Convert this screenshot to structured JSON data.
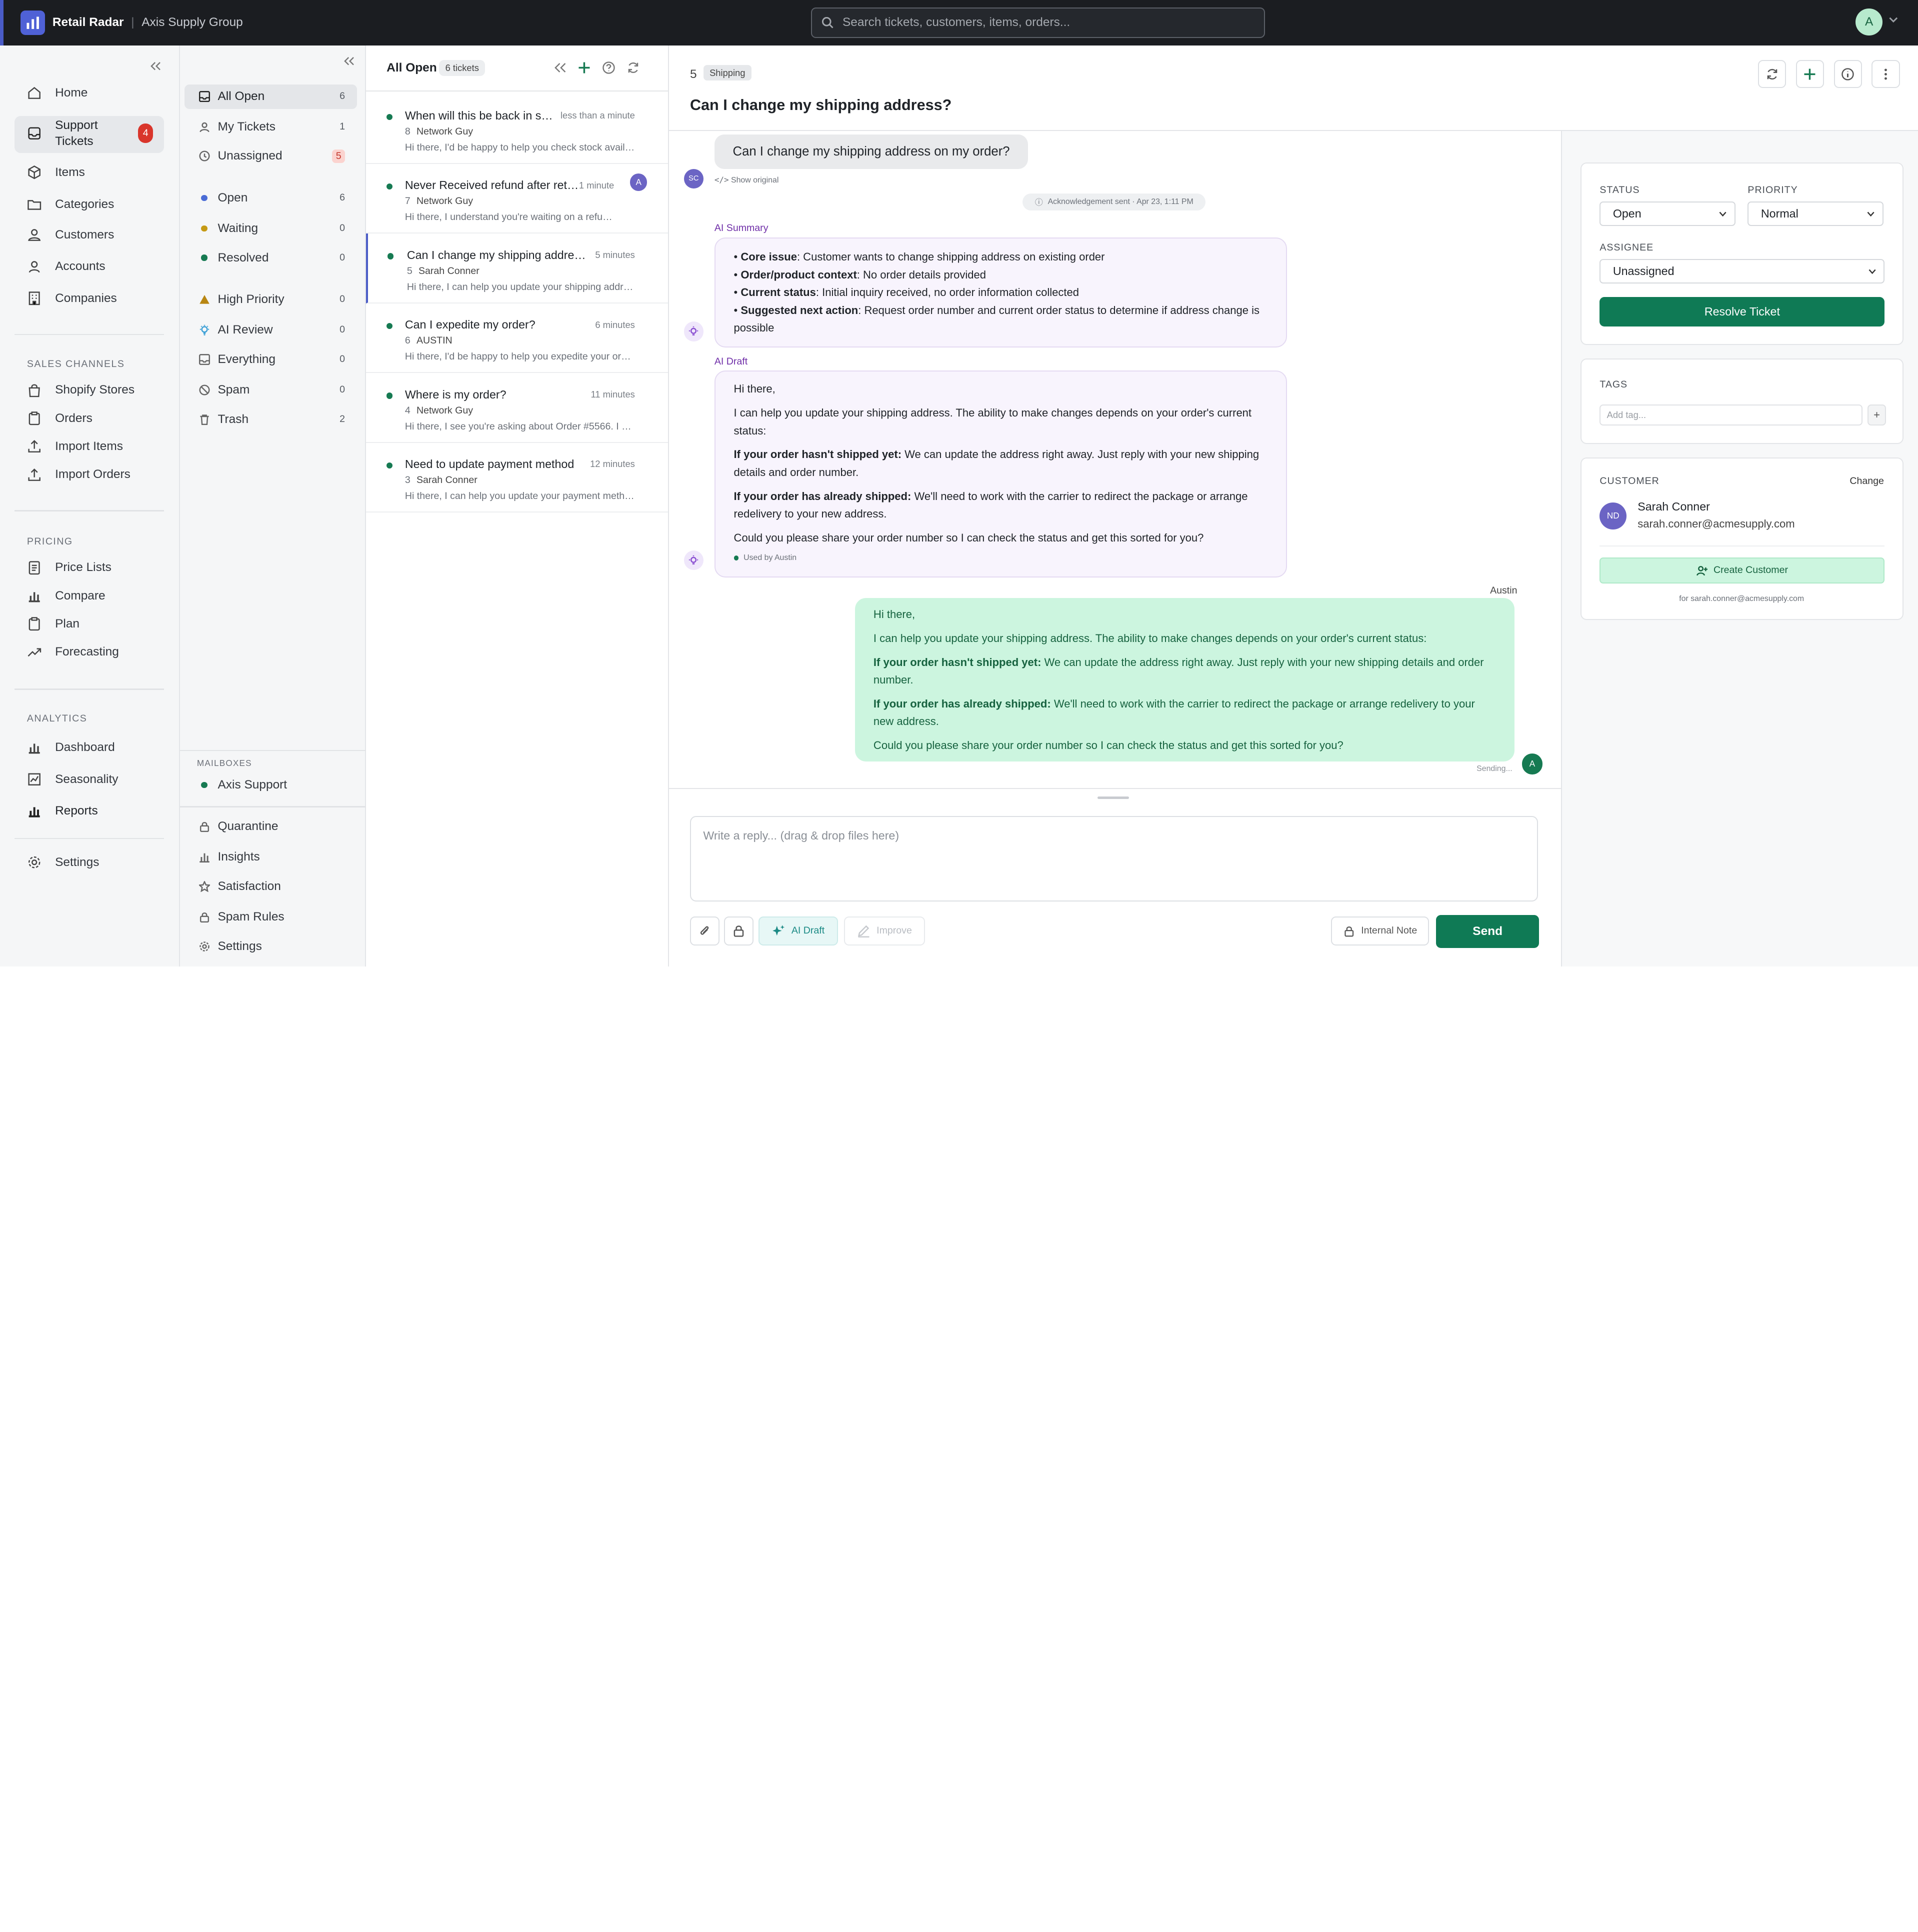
{
  "topbar": {
    "app_name": "Retail Radar",
    "separator": "|",
    "org_name": "Axis Supply Group",
    "search_placeholder": "Search tickets, customers, items, orders...",
    "user_initial": "A"
  },
  "nav": {
    "items": [
      {
        "label": "Home",
        "icon": "home-icon"
      },
      {
        "label": "Support\nTickets",
        "icon": "inbox-icon",
        "badge": "4"
      },
      {
        "label": "Items",
        "icon": "box-icon"
      },
      {
        "label": "Categories",
        "icon": "folder-icon"
      },
      {
        "label": "Customers",
        "icon": "users-icon"
      },
      {
        "label": "Accounts",
        "icon": "user-icon"
      },
      {
        "label": "Companies",
        "icon": "building-icon"
      }
    ],
    "sales_title": "SALES CHANNELS",
    "sales": [
      "Shopify Stores",
      "Orders",
      "Import Items",
      "Import Orders"
    ],
    "pricing_title": "PRICING",
    "pricing": [
      "Price Lists",
      "Compare",
      "Plan",
      "Forecasting"
    ],
    "analytics_title": "ANALYTICS",
    "analytics": [
      "Dashboard",
      "Seasonality",
      "Reports"
    ],
    "settings": "Settings"
  },
  "folders": {
    "items": [
      {
        "label": "All Open",
        "count": "6"
      },
      {
        "label": "My Tickets",
        "count": "1"
      },
      {
        "label": "Unassigned",
        "count": "5"
      },
      {
        "label": "Open",
        "count": "6",
        "color": "#4a6cd6"
      },
      {
        "label": "Waiting",
        "count": "0",
        "color": "#c59a14"
      },
      {
        "label": "Resolved",
        "count": "0",
        "color": "#167a52"
      },
      {
        "label": "High Priority",
        "count": "0"
      },
      {
        "label": "AI Review",
        "count": "0"
      },
      {
        "label": "Everything",
        "count": "0"
      },
      {
        "label": "Spam",
        "count": "0"
      },
      {
        "label": "Trash",
        "count": "2"
      }
    ],
    "mailboxes_title": "MAILBOXES",
    "mailbox": "Axis Support",
    "bottom": [
      "Quarantine",
      "Insights",
      "Satisfaction",
      "Spam Rules",
      "Settings"
    ]
  },
  "ticket_list": {
    "title": "All Open",
    "count": "6 tickets",
    "tickets": [
      {
        "subject": "When will this be back in sto...",
        "time": "less than a minute",
        "num": "8",
        "from": "Network Guy",
        "preview": "Hi there, I'd be happy to help you check stock availa..."
      },
      {
        "subject": "Never Received refund after return",
        "time": "1 minute",
        "num": "7",
        "from": "Network Guy",
        "preview": "Hi there, I understand you're waiting on a refun...",
        "avatar": "A"
      },
      {
        "subject": "Can I change my shipping address?",
        "time": "5 minutes",
        "num": "5",
        "from": "Sarah Conner",
        "preview": "Hi there, I can help you update your shipping addre..."
      },
      {
        "subject": "Can I expedite my order?",
        "time": "6 minutes",
        "num": "6",
        "from": "AUSTIN",
        "preview": "Hi there, I'd be happy to help you expedite your orde..."
      },
      {
        "subject": "Where is my order?",
        "time": "11 minutes",
        "num": "4",
        "from": "Network Guy",
        "preview": "Hi there, I see you're asking about Order #5566. I d..."
      },
      {
        "subject": "Need to update payment method",
        "time": "12 minutes",
        "num": "3",
        "from": "Sarah Conner",
        "preview": "Hi there, I can help you update your payment metho..."
      }
    ]
  },
  "conversation": {
    "number": "5",
    "tag": "Shipping",
    "title": "Can I change my shipping address?",
    "customer_message": "Can I change my shipping address on my order?",
    "customer_initials": "SC",
    "show_original": "Show original",
    "ack": "Acknowledgement sent · Apr 23, 1:11 PM",
    "ai_summary_label": "AI Summary",
    "summary": [
      {
        "key": "Core issue",
        "text": ": Customer wants to change shipping address on existing order"
      },
      {
        "key": "Order/product context",
        "text": ": No order details provided"
      },
      {
        "key": "Current status",
        "text": ": Initial inquiry received, no order information collected"
      },
      {
        "key": "Suggested next action",
        "text": ": Request order number and current order status to determine if address change is possible"
      }
    ],
    "ai_draft_label": "AI Draft",
    "draft": {
      "greeting": "Hi there,",
      "intro": "I can help you update your shipping address. The ability to make changes depends on your order's current status:",
      "p1_key": "If your order hasn't shipped yet:",
      "p1_text": " We can update the address right away. Just reply with your new shipping details and order number.",
      "p2_key": "If your order has already shipped:",
      "p2_text": " We'll need to work with the carrier to redirect the package or arrange redelivery to your new address.",
      "closing": "Could you please share your order number so I can check the status and get this sorted for you?",
      "used_by": "Used by Austin"
    },
    "agent_name": "Austin",
    "agent_initial": "A",
    "sending": "Sending...",
    "reply_placeholder": "Write a reply... (drag & drop files here)",
    "ai_draft_button": "AI Draft",
    "improve_button": "Improve",
    "internal_note_button": "Internal Note",
    "send_button": "Send"
  },
  "details": {
    "status_label": "STATUS",
    "status_value": "Open",
    "priority_label": "PRIORITY",
    "priority_value": "Normal",
    "assignee_label": "ASSIGNEE",
    "assignee_value": "Unassigned",
    "resolve_button": "Resolve Ticket",
    "tags_label": "TAGS",
    "tag_placeholder": "Add tag...",
    "tag_add": "+",
    "customer_label": "CUSTOMER",
    "change_link": "Change",
    "customer_initials": "ND",
    "customer_name": "Sarah Conner",
    "customer_email": "sarah.conner@acmesupply.com",
    "create_customer": "Create Customer",
    "create_for": "for sarah.conner@acmesupply.com"
  },
  "colors": {
    "brand": "#4f61d6",
    "accent_green": "#0f7a55",
    "badge_red": "#d9352b",
    "ai_purple": "#6f2ea8"
  }
}
